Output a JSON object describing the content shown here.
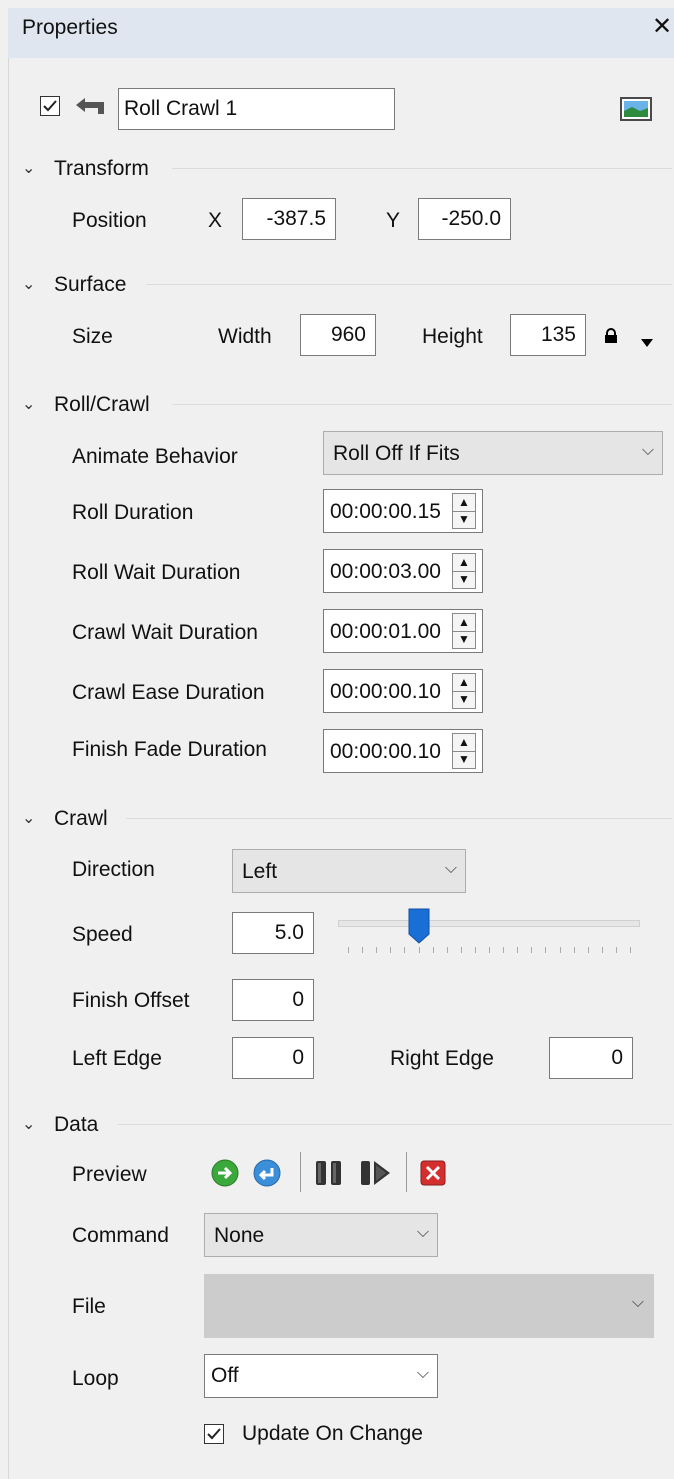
{
  "panel": {
    "title": "Properties",
    "close_icon": "close-icon"
  },
  "layer": {
    "enabled": true,
    "name": "Roll Crawl 1"
  },
  "transform": {
    "title": "Transform",
    "position_label": "Position",
    "x_label": "X",
    "x_value": "-387.5",
    "y_label": "Y",
    "y_value": "-250.0"
  },
  "surface": {
    "title": "Surface",
    "size_label": "Size",
    "width_label": "Width",
    "width_value": "960",
    "height_label": "Height",
    "height_value": "135"
  },
  "rollcrawl": {
    "title": "Roll/Crawl",
    "animate_label": "Animate Behavior",
    "animate_value": "Roll Off If Fits",
    "roll_duration_label": "Roll Duration",
    "roll_duration_value": "00:00:00.15",
    "roll_wait_label": "Roll Wait Duration",
    "roll_wait_value": "00:00:03.00",
    "crawl_wait_label": "Crawl Wait Duration",
    "crawl_wait_value": "00:00:01.00",
    "crawl_ease_label": "Crawl Ease Duration",
    "crawl_ease_value": "00:00:00.10",
    "finish_fade_label": "Finish Fade Duration",
    "finish_fade_value": "00:00:00.10"
  },
  "crawl": {
    "title": "Crawl",
    "direction_label": "Direction",
    "direction_value": "Left",
    "speed_label": "Speed",
    "speed_value": "5.0",
    "speed_slider_fraction": 0.25,
    "finish_offset_label": "Finish Offset",
    "finish_offset_value": "0",
    "left_edge_label": "Left Edge",
    "left_edge_value": "0",
    "right_edge_label": "Right Edge",
    "right_edge_value": "0"
  },
  "data": {
    "title": "Data",
    "preview_label": "Preview",
    "command_label": "Command",
    "command_value": "None",
    "file_label": "File",
    "file_value": "",
    "loop_label": "Loop",
    "loop_value": "Off",
    "update_on_change_label": "Update On Change",
    "update_on_change": true
  },
  "colors": {
    "title_bar": "#dfe6ef",
    "panel_bg": "#f0f0f0",
    "slider_thumb": "#1a6fd6",
    "stop_red": "#d32f2f",
    "play_green": "#3aa83a"
  }
}
